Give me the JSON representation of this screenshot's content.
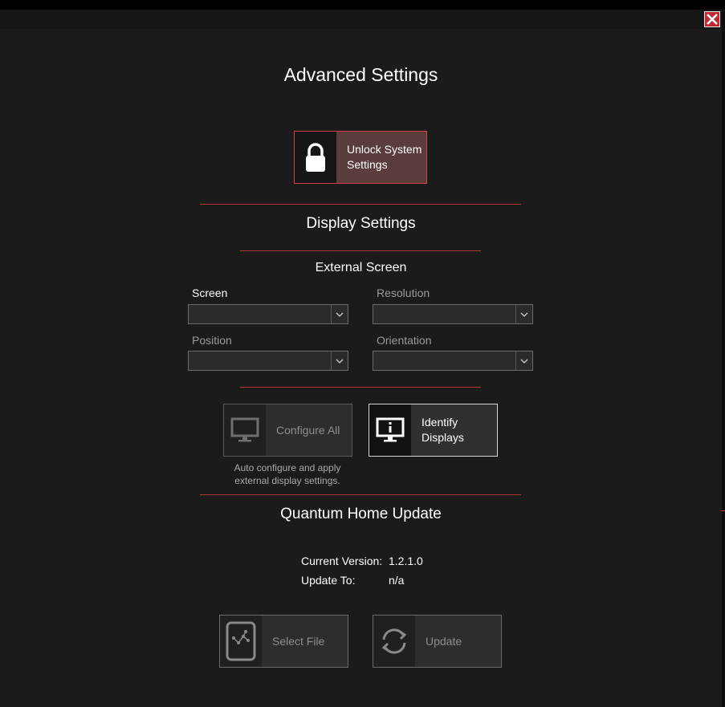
{
  "window": {
    "close_icon": "close-x-icon",
    "accent_color": "#c1272d"
  },
  "title": "Advanced Settings",
  "unlock": {
    "label_line1": "Unlock System",
    "label_line2": "Settings",
    "icon": "lock-icon"
  },
  "display": {
    "heading": "Display Settings",
    "external_heading": "External Screen",
    "fields": {
      "screen": {
        "label": "Screen",
        "value": ""
      },
      "resolution": {
        "label": "Resolution",
        "value": ""
      },
      "position": {
        "label": "Position",
        "value": ""
      },
      "orientation": {
        "label": "Orientation",
        "value": ""
      }
    },
    "configure_all": {
      "label": "Configure All",
      "icon": "monitor-icon",
      "hint_line1": "Auto configure and apply",
      "hint_line2": "external display settings."
    },
    "identify": {
      "label_line1": "Identify",
      "label_line2": "Displays",
      "icon": "monitor-info-icon"
    }
  },
  "update": {
    "heading": "Quantum Home Update",
    "current_label": "Current Version:",
    "current_value": "1.2.1.0",
    "update_to_label": "Update To:",
    "update_to_value": "n/a",
    "select_file": {
      "label": "Select File",
      "icon": "file-icon"
    },
    "update_button": {
      "label": "Update",
      "icon": "refresh-icon"
    }
  }
}
